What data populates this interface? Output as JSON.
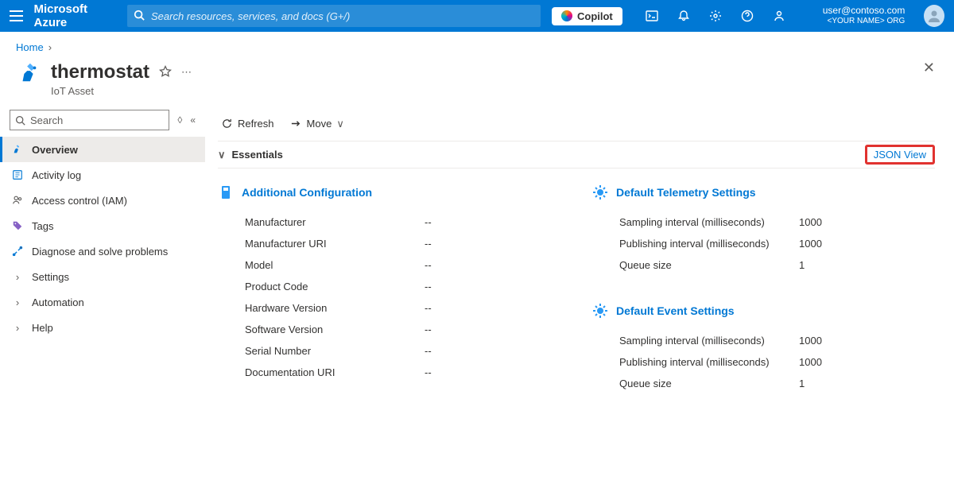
{
  "header": {
    "brand": "Microsoft Azure",
    "searchPlaceholder": "Search resources, services, and docs (G+/)",
    "copilotLabel": "Copilot",
    "user": {
      "email": "user@contoso.com",
      "org": "<YOUR NAME> ORG"
    }
  },
  "breadcrumb": {
    "home": "Home"
  },
  "resource": {
    "title": "thermostat",
    "type": "IoT Asset"
  },
  "sidebar": {
    "searchPlaceholder": "Search",
    "items": [
      {
        "label": "Overview",
        "selected": true
      },
      {
        "label": "Activity log"
      },
      {
        "label": "Access control (IAM)"
      },
      {
        "label": "Tags"
      },
      {
        "label": "Diagnose and solve problems"
      },
      {
        "label": "Settings"
      },
      {
        "label": "Automation"
      },
      {
        "label": "Help"
      }
    ]
  },
  "commands": {
    "refresh": "Refresh",
    "move": "Move"
  },
  "essentials": {
    "label": "Essentials",
    "jsonView": "JSON View"
  },
  "sections": {
    "additional": {
      "title": "Additional Configuration",
      "rows": [
        {
          "label": "Manufacturer",
          "value": "--"
        },
        {
          "label": "Manufacturer URI",
          "value": "--"
        },
        {
          "label": "Model",
          "value": "--"
        },
        {
          "label": "Product Code",
          "value": "--"
        },
        {
          "label": "Hardware Version",
          "value": "--"
        },
        {
          "label": "Software Version",
          "value": "--"
        },
        {
          "label": "Serial Number",
          "value": "--"
        },
        {
          "label": "Documentation URI",
          "value": "--"
        }
      ]
    },
    "telemetry": {
      "title": "Default Telemetry Settings",
      "rows": [
        {
          "label": "Sampling interval (milliseconds)",
          "value": "1000"
        },
        {
          "label": "Publishing interval (milliseconds)",
          "value": "1000"
        },
        {
          "label": "Queue size",
          "value": "1"
        }
      ]
    },
    "events": {
      "title": "Default Event Settings",
      "rows": [
        {
          "label": "Sampling interval (milliseconds)",
          "value": "1000"
        },
        {
          "label": "Publishing interval (milliseconds)",
          "value": "1000"
        },
        {
          "label": "Queue size",
          "value": "1"
        }
      ]
    }
  }
}
